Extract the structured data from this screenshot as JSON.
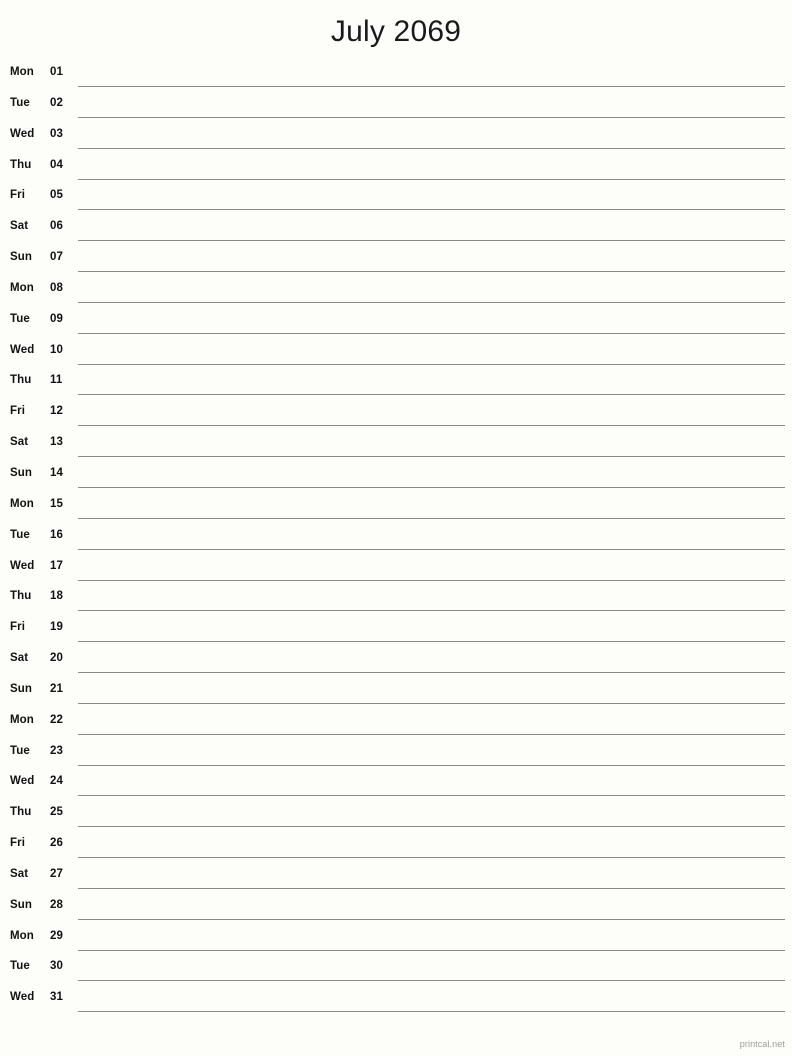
{
  "document": {
    "title": "July 2069",
    "month": "July",
    "year": "2069",
    "footer": "printcal.net",
    "line_color": "#8a8a8a",
    "text_color": "#111111",
    "background_color": "#fdfdfa",
    "footer_color": "#9b9b9b"
  },
  "days": [
    {
      "weekday": "Mon",
      "number": "01"
    },
    {
      "weekday": "Tue",
      "number": "02"
    },
    {
      "weekday": "Wed",
      "number": "03"
    },
    {
      "weekday": "Thu",
      "number": "04"
    },
    {
      "weekday": "Fri",
      "number": "05"
    },
    {
      "weekday": "Sat",
      "number": "06"
    },
    {
      "weekday": "Sun",
      "number": "07"
    },
    {
      "weekday": "Mon",
      "number": "08"
    },
    {
      "weekday": "Tue",
      "number": "09"
    },
    {
      "weekday": "Wed",
      "number": "10"
    },
    {
      "weekday": "Thu",
      "number": "11"
    },
    {
      "weekday": "Fri",
      "number": "12"
    },
    {
      "weekday": "Sat",
      "number": "13"
    },
    {
      "weekday": "Sun",
      "number": "14"
    },
    {
      "weekday": "Mon",
      "number": "15"
    },
    {
      "weekday": "Tue",
      "number": "16"
    },
    {
      "weekday": "Wed",
      "number": "17"
    },
    {
      "weekday": "Thu",
      "number": "18"
    },
    {
      "weekday": "Fri",
      "number": "19"
    },
    {
      "weekday": "Sat",
      "number": "20"
    },
    {
      "weekday": "Sun",
      "number": "21"
    },
    {
      "weekday": "Mon",
      "number": "22"
    },
    {
      "weekday": "Tue",
      "number": "23"
    },
    {
      "weekday": "Wed",
      "number": "24"
    },
    {
      "weekday": "Thu",
      "number": "25"
    },
    {
      "weekday": "Fri",
      "number": "26"
    },
    {
      "weekday": "Sat",
      "number": "27"
    },
    {
      "weekday": "Sun",
      "number": "28"
    },
    {
      "weekday": "Mon",
      "number": "29"
    },
    {
      "weekday": "Tue",
      "number": "30"
    },
    {
      "weekday": "Wed",
      "number": "31"
    }
  ]
}
